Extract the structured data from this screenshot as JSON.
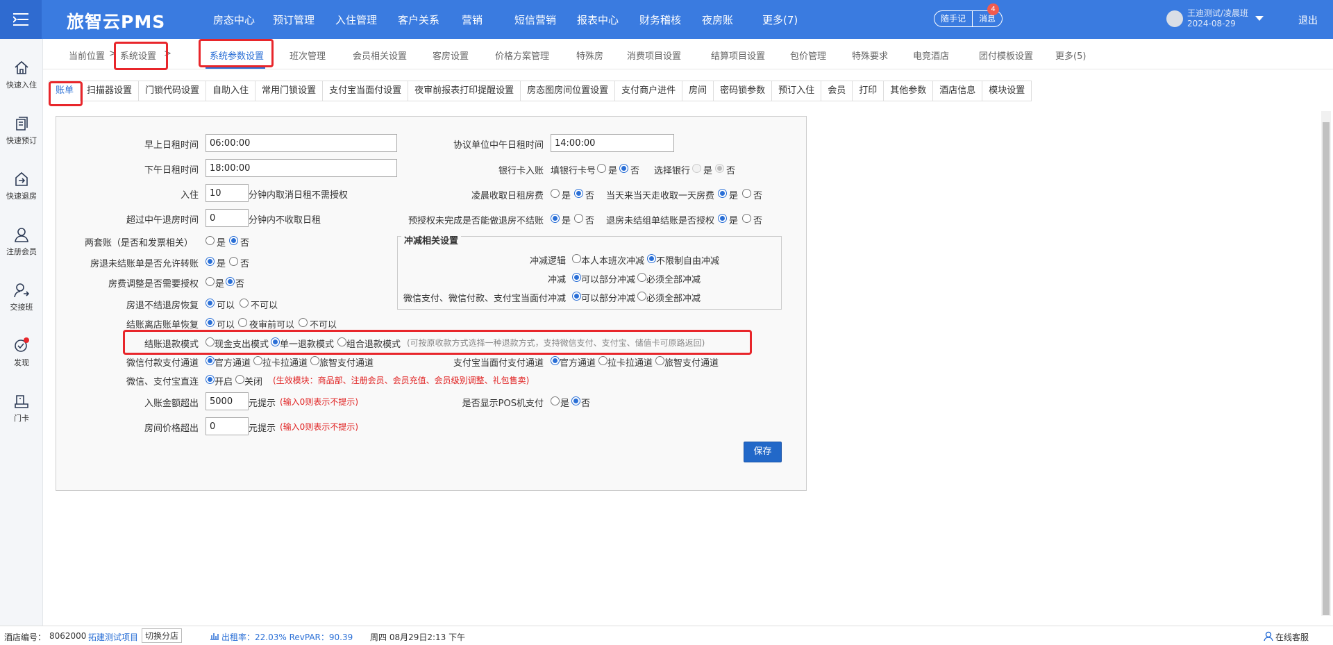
{
  "app": {
    "title": "旅智云PMS"
  },
  "topnav": [
    "房态中心",
    "预订管理",
    "入住管理",
    "客户关系",
    "营销",
    "短信营销",
    "报表中心",
    "财务稽核",
    "夜房账",
    "更多(7)"
  ],
  "pills": {
    "notes": "随手记",
    "messages": "消息",
    "message_count": "4"
  },
  "user": {
    "name": "王迪测试/凌晨班",
    "date": "2024-08-29",
    "logout": "退出"
  },
  "sidebar": [
    "快速入住",
    "快速预订",
    "快速退房",
    "注册会员",
    "交接班",
    "发现",
    "门卡"
  ],
  "breadcrumb": {
    "label": "当前位置",
    "sep": ">",
    "current": "系统设置",
    "sep2": ">"
  },
  "tabs2": [
    "系统参数设置",
    "班次管理",
    "会员相关设置",
    "客房设置",
    "价格方案管理",
    "特殊房",
    "消费项目设置",
    "结算项目设置",
    "包价管理",
    "特殊要求",
    "电竞酒店",
    "团付模板设置",
    "更多(5)"
  ],
  "tabs3": [
    "账单",
    "扫描器设置",
    "门锁代码设置",
    "自助入住",
    "常用门锁设置",
    "支付宝当面付设置",
    "夜审前报表打印提醒设置",
    "房态图房间位置设置",
    "支付商户进件",
    "房间",
    "密码锁参数",
    "预订入住",
    "会员",
    "打印",
    "其他参数",
    "酒店信息",
    "模块设置"
  ],
  "form": {
    "early_rent_label": "早上日租时间",
    "early_rent_value": "06:00:00",
    "afternoon_rent_label": "下午日租时间",
    "afternoon_rent_value": "18:00:00",
    "checkin_label": "入住",
    "checkin_value": "10",
    "checkin_suffix": "分钟内取消日租不需授权",
    "noon_over_label": "超过中午退房时间",
    "noon_over_value": "0",
    "noon_over_suffix": "分钟内不收取日租",
    "two_accounts_label": "两套账（是否和发票相关）",
    "transfer_label": "房退未结账单是否允许转账",
    "adjust_label": "房费调整是否需要授权",
    "restore_label": "房退不结退房恢复",
    "leave_restore_label": "结账离店账单恢复",
    "refund_mode_label": "结账退款模式",
    "refund_opt1": "现金支出模式",
    "refund_opt2": "单一退款模式",
    "refund_opt3": "组合退款模式",
    "refund_note": "(可按原收款方式选择一种退款方式，支持微信支付、支付宝、储值卡可原路返回)",
    "wechat_channel_label": "微信付款支付通道",
    "chan_official": "官方通道",
    "chan_lakala": "拉卡拉通道",
    "chan_lvzhi": "旅智支付通道",
    "direct_label": "微信、支付宝直连",
    "direct_on": "开启",
    "direct_off": "关闭",
    "direct_note": "(生效模块：商品部、注册会员、会员充值、会员级别调整、礼包售卖)",
    "amount_over_label": "入账金额超出",
    "amount_over_value": "5000",
    "amount_over_suffix": "元提示",
    "zero_note": "(输入0则表示不提示)",
    "room_price_label": "房间价格超出",
    "room_price_value": "0",
    "room_price_suffix": "元提示",
    "agreement_label": "协议单位中午日租时间",
    "agreement_value": "14:00:00",
    "bankcard_label": "银行卡入账",
    "fill_card": "填银行卡号",
    "choose_bank": "选择银行",
    "yes": "是",
    "no": "否",
    "early_fee_label": "凌晨收取日租房费",
    "same_day_label": "当天来当天走收取一天房费",
    "preauth_label": "预授权未完成是否能做退房不结账",
    "unsettled_label": "退房未结组单结账是否授权",
    "offset_legend": "冲减相关设置",
    "offset_logic_label": "冲减逻辑",
    "offset_logic_opt1": "本人本班次冲减",
    "offset_logic_opt2": "不限制自由冲减",
    "offset_label": "冲减",
    "offset_opt1": "可以部分冲减",
    "offset_opt2": "必须全部冲减",
    "offset_pay_label": "微信支付、微信付款、支付宝当面付冲减",
    "can": "可以",
    "cannot": "不可以",
    "before_audit": "夜审前可以",
    "alipay_channel_label": "支付宝当面付支付通道",
    "pos_label": "是否显示POS机支付",
    "save": "保存"
  },
  "footer": {
    "hotel_no_label": "酒店编号：",
    "hotel_no": "8062000",
    "project": "拓建测试项目",
    "switch": "切换分店",
    "occupancy": "出租率：22.03% RevPAR：90.39",
    "datetime": "周四 08月29日2:13 下午",
    "service": "在线客服"
  }
}
